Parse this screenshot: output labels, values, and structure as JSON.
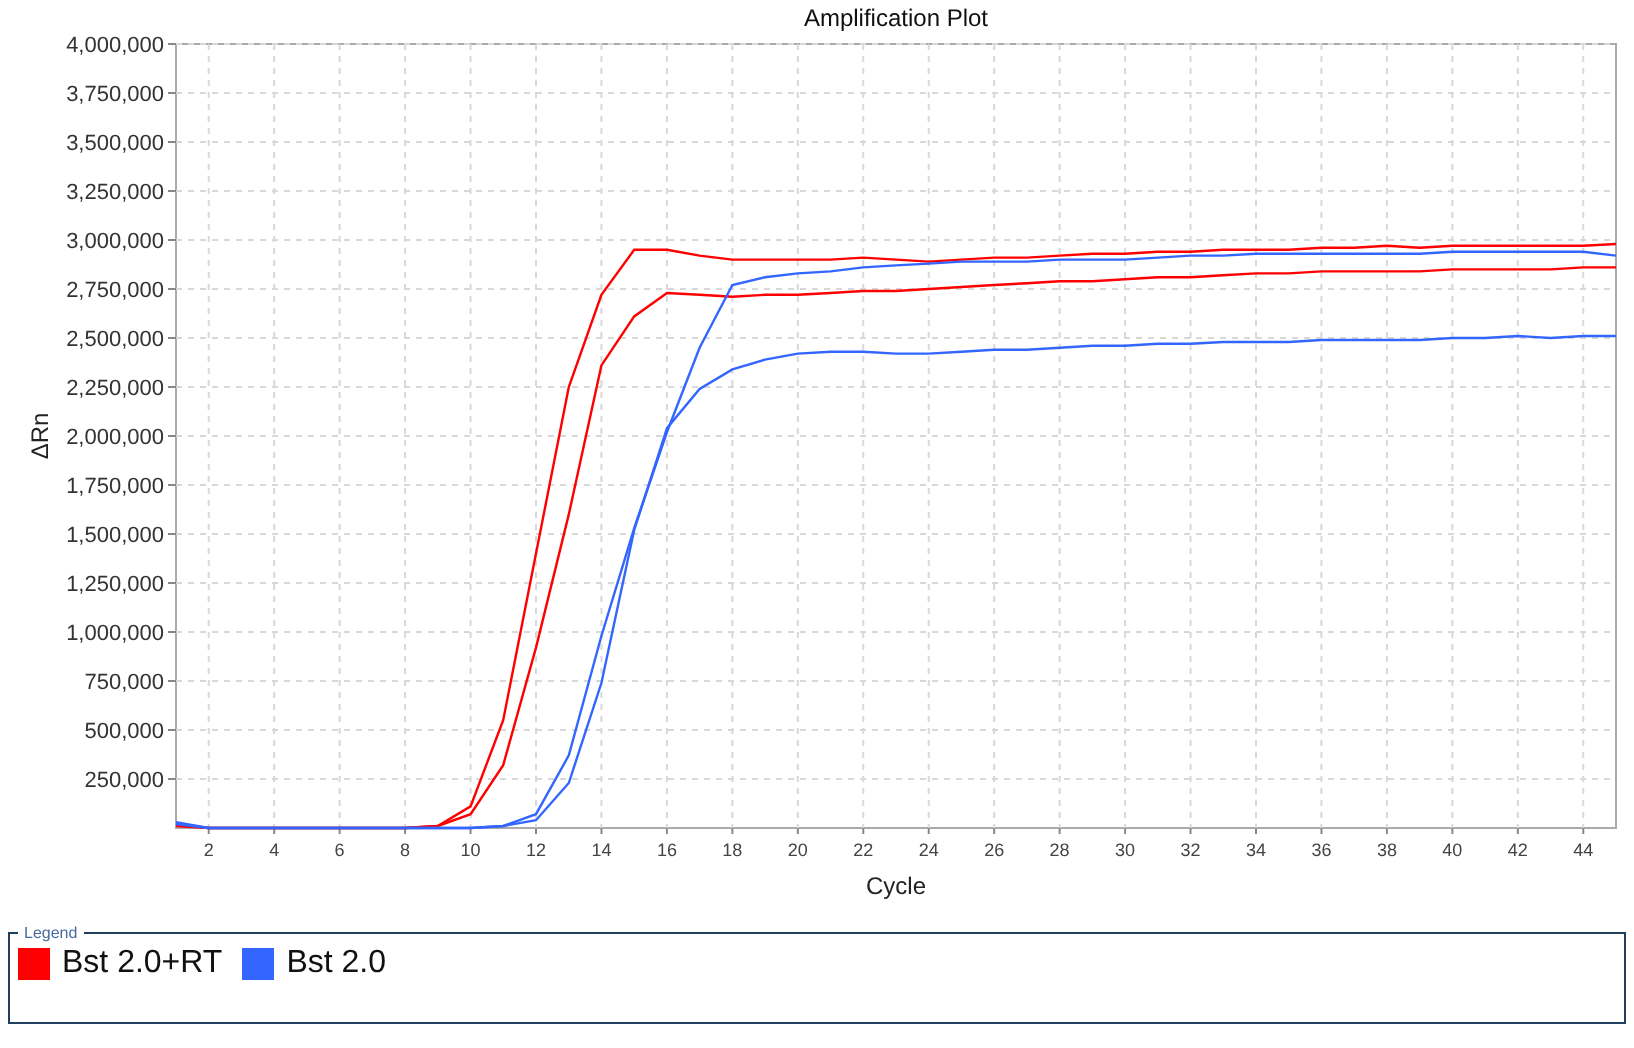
{
  "chart": {
    "chart_data": {
      "type": "line",
      "title": "Amplification Plot",
      "xlabel": "Cycle",
      "ylabel": "ΔRn",
      "x": [
        1,
        2,
        3,
        4,
        5,
        6,
        7,
        8,
        9,
        10,
        11,
        12,
        13,
        14,
        15,
        16,
        17,
        18,
        19,
        20,
        21,
        22,
        23,
        24,
        25,
        26,
        27,
        28,
        29,
        30,
        31,
        32,
        33,
        34,
        35,
        36,
        37,
        38,
        39,
        40,
        41,
        42,
        43,
        44,
        45
      ],
      "grid": true,
      "xlim": [
        1,
        45
      ],
      "ylim": [
        0,
        4000000
      ],
      "xticks": [
        2,
        4,
        6,
        8,
        10,
        12,
        14,
        16,
        18,
        20,
        22,
        24,
        26,
        28,
        30,
        32,
        34,
        36,
        38,
        40,
        42,
        44
      ],
      "yticks": [
        {
          "value": 250000,
          "label": "250,000"
        },
        {
          "value": 500000,
          "label": "500,000"
        },
        {
          "value": 750000,
          "label": "750,000"
        },
        {
          "value": 1000000,
          "label": "1,000,000"
        },
        {
          "value": 1250000,
          "label": "1,250,000"
        },
        {
          "value": 1500000,
          "label": "1,500,000"
        },
        {
          "value": 1750000,
          "label": "1,750,000"
        },
        {
          "value": 2000000,
          "label": "2,000,000"
        },
        {
          "value": 2250000,
          "label": "2,250,000"
        },
        {
          "value": 2500000,
          "label": "2,500,000"
        },
        {
          "value": 2750000,
          "label": "2,750,000"
        },
        {
          "value": 3000000,
          "label": "3,000,000"
        },
        {
          "value": 3250000,
          "label": "3,250,000"
        },
        {
          "value": 3500000,
          "label": "3,500,000"
        },
        {
          "value": 3750000,
          "label": "3,750,000"
        },
        {
          "value": 4000000,
          "label": "4,000,000"
        }
      ],
      "series": [
        {
          "name": "Bst 2.0+RT",
          "color": "#ff0000",
          "values": [
            20000,
            0,
            0,
            0,
            0,
            0,
            0,
            0,
            10000,
            110000,
            550000,
            1400000,
            2250000,
            2720000,
            2950000,
            2950000,
            2920000,
            2900000,
            2900000,
            2900000,
            2900000,
            2910000,
            2900000,
            2890000,
            2900000,
            2910000,
            2910000,
            2920000,
            2930000,
            2930000,
            2940000,
            2940000,
            2950000,
            2950000,
            2950000,
            2960000,
            2960000,
            2970000,
            2960000,
            2970000,
            2970000,
            2970000,
            2970000,
            2970000,
            2980000
          ]
        },
        {
          "color": "#ff0000",
          "values": [
            10000,
            0,
            0,
            0,
            0,
            0,
            0,
            0,
            10000,
            70000,
            320000,
            920000,
            1600000,
            2360000,
            2610000,
            2730000,
            2720000,
            2710000,
            2720000,
            2720000,
            2730000,
            2740000,
            2740000,
            2750000,
            2760000,
            2770000,
            2780000,
            2790000,
            2790000,
            2800000,
            2810000,
            2810000,
            2820000,
            2830000,
            2830000,
            2840000,
            2840000,
            2840000,
            2840000,
            2850000,
            2850000,
            2850000,
            2850000,
            2860000,
            2860000
          ]
        },
        {
          "name": "Bst 2.0",
          "color": "#3366ff",
          "values": [
            30000,
            0,
            0,
            0,
            0,
            0,
            0,
            0,
            0,
            0,
            10000,
            70000,
            370000,
            980000,
            1530000,
            2020000,
            2450000,
            2770000,
            2810000,
            2830000,
            2840000,
            2860000,
            2870000,
            2880000,
            2890000,
            2890000,
            2890000,
            2900000,
            2900000,
            2900000,
            2910000,
            2920000,
            2920000,
            2930000,
            2930000,
            2930000,
            2930000,
            2930000,
            2930000,
            2940000,
            2940000,
            2940000,
            2940000,
            2940000,
            2920000
          ]
        },
        {
          "color": "#3366ff",
          "values": [
            20000,
            0,
            0,
            0,
            0,
            0,
            0,
            0,
            0,
            0,
            10000,
            40000,
            230000,
            740000,
            1520000,
            2040000,
            2240000,
            2340000,
            2390000,
            2420000,
            2430000,
            2430000,
            2420000,
            2420000,
            2430000,
            2440000,
            2440000,
            2450000,
            2460000,
            2460000,
            2470000,
            2470000,
            2480000,
            2480000,
            2480000,
            2490000,
            2490000,
            2490000,
            2490000,
            2500000,
            2500000,
            2510000,
            2500000,
            2510000,
            2510000
          ]
        }
      ]
    }
  },
  "legend": {
    "title": "Legend"
  }
}
